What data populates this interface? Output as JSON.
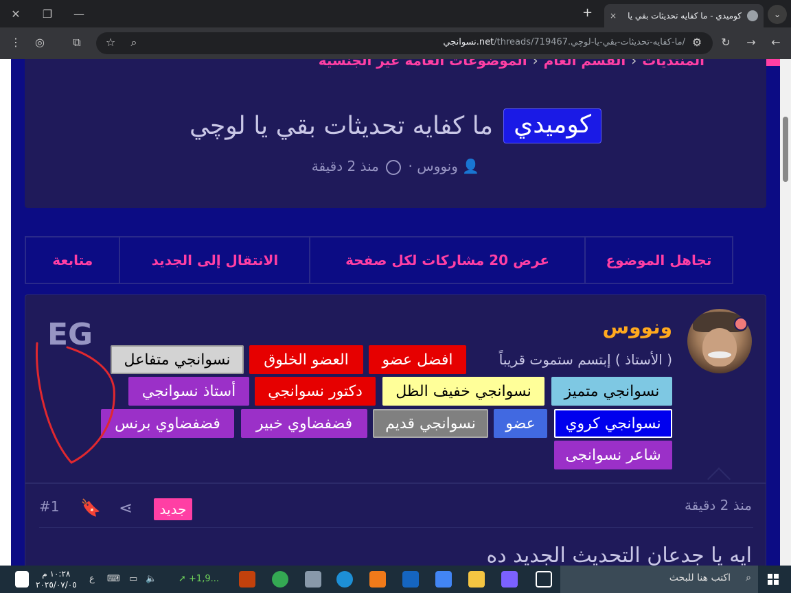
{
  "browser": {
    "tab_title": "كوميدي - ما كفايه تحديثات بقي يا",
    "tab_close": "×",
    "new_tab": "+",
    "url_host": "نسوانجي.net",
    "url_path": "/threads/719467.ما-كفايه-تحديثات-بقي-يا-لوچي/"
  },
  "breadcrumbs": [
    "المنتديات",
    "القسم العام",
    "الموضوعات العامة غير الجنسية"
  ],
  "thread": {
    "prefix": "كوميدي",
    "title": "ما كفايه تحديثات بقي يا لوچي",
    "author": "ونووس",
    "time": "منذ 2 دقيقة"
  },
  "actions": [
    "تجاهل الموضوع",
    "عرض 20 مشاركات لكل صفحة",
    "الانتقال إلى الجديد",
    "متابعة"
  ],
  "post": {
    "username": "ونووس",
    "user_title": "( الأستاذ ) إبتسم ستموت قريباً",
    "watermark": "EG",
    "badges": [
      {
        "label": "افضل عضو",
        "bg": "#e60000",
        "fg": "#ffffff"
      },
      {
        "label": "العضو الخلوق",
        "bg": "#e60000",
        "fg": "#ffffff"
      },
      {
        "label": "نسوانجي متفاعل",
        "bg": "#d3d3d3",
        "fg": "#000000"
      },
      {
        "label": "نسوانجي متميز",
        "bg": "#7ec8e3",
        "fg": "#000000"
      },
      {
        "label": "نسوانجي خفيف الظل",
        "bg": "#ffff99",
        "fg": "#000000"
      },
      {
        "label": "دكتور نسوانجي",
        "bg": "#e60000",
        "fg": "#ffffff"
      },
      {
        "label": "أستاذ نسوانجي",
        "bg": "#9b30c8",
        "fg": "#ffffff"
      },
      {
        "label": "نسوانجي كروي",
        "bg": "#0000ee",
        "fg": "#ffffff"
      },
      {
        "label": "عضو",
        "bg": "#4169e1",
        "fg": "#ffffff"
      },
      {
        "label": "نسوانجي قديم",
        "bg": "#808080",
        "fg": "#ffffff"
      },
      {
        "label": "فضفضاوي خبير",
        "bg": "#9b30c8",
        "fg": "#ffffff"
      },
      {
        "label": "فضفضاوي برنس",
        "bg": "#9b30c8",
        "fg": "#ffffff"
      },
      {
        "label": "شاعر نسوانجى",
        "bg": "#9b30c8",
        "fg": "#ffffff"
      }
    ],
    "time": "منذ 2 دقيقة",
    "new_label": "جديد",
    "post_number": "#1",
    "body_start": "ايه يا جدعان التحديث الجديد ده"
  },
  "taskbar": {
    "search_placeholder": "اكتب هنا للبحث",
    "time": "١٠:٢٨ م",
    "date": "٢٠٢٥/٠٧/٠٥",
    "lang": "ع",
    "stock": "+1,9..."
  },
  "colors": {
    "accent": "#ff3fa4",
    "page_bg": "#0c0c84",
    "card_bg": "#1f1a5a",
    "username": "#ffa91e"
  }
}
